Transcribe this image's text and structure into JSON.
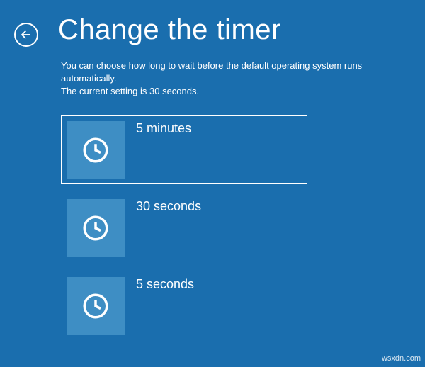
{
  "header": {
    "title": "Change the timer"
  },
  "description": {
    "line1": "You can choose how long to wait before the default operating system runs automatically.",
    "line2": "The current setting is 30 seconds."
  },
  "options": [
    {
      "label": "5 minutes",
      "selected": true
    },
    {
      "label": "30 seconds",
      "selected": false
    },
    {
      "label": "5 seconds",
      "selected": false
    }
  ],
  "watermark": "wsxdn.com"
}
